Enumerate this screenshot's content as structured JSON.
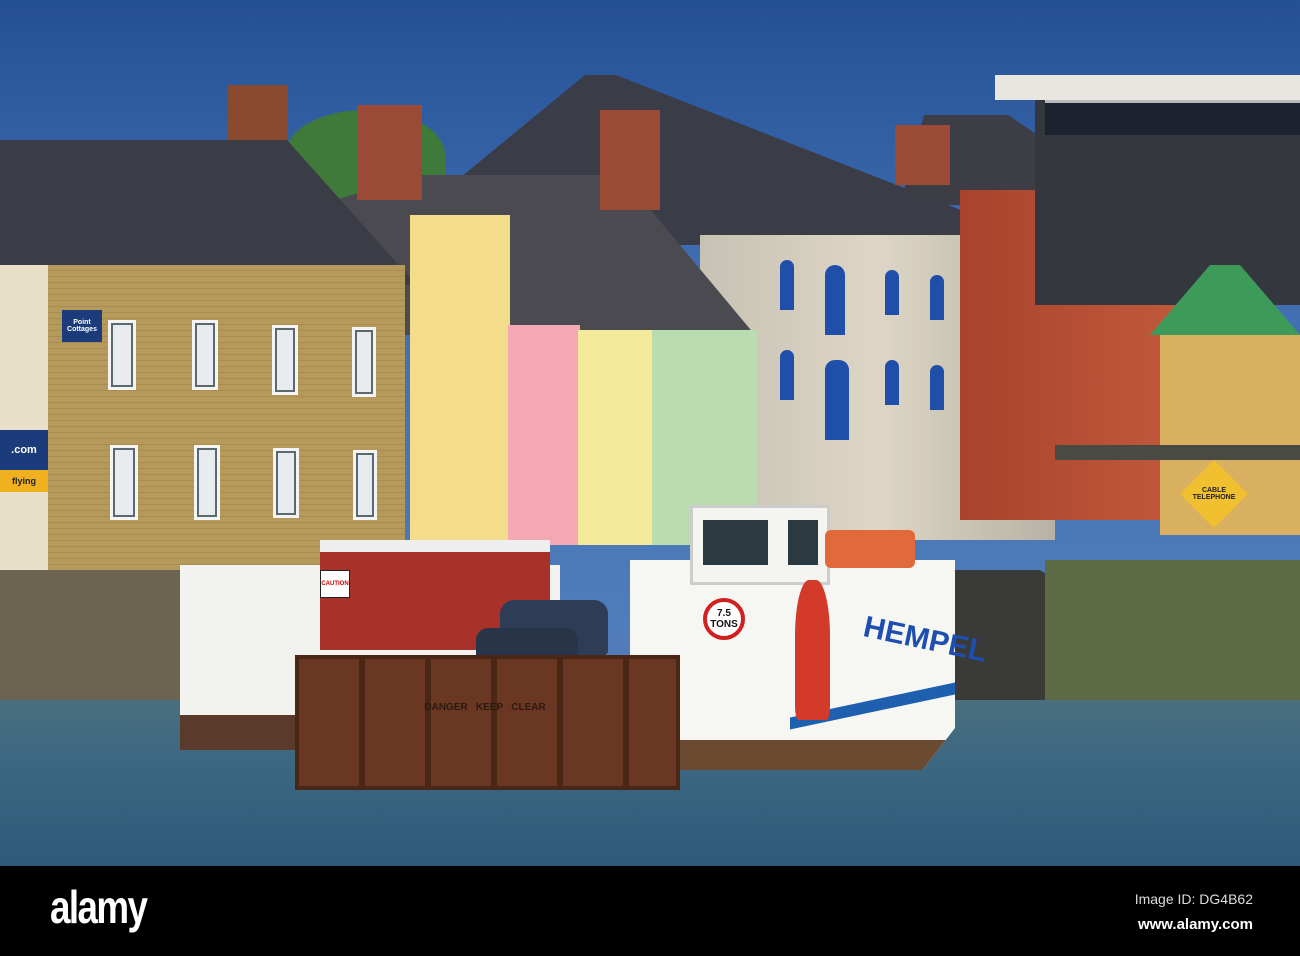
{
  "photo": {
    "signs": {
      "point_cottages": "Point Cottages",
      "flying": "flying",
      "com": ".com",
      "caution": "CAUTION",
      "tons_value": "7.5",
      "tons_unit": "TONS",
      "ramp": "DANGER   KEEP   CLEAR",
      "hull": "HEMPEL",
      "cable_telephone": "CABLE TELEPHONE"
    },
    "colors": {
      "sky": "#2f5ca4",
      "water": "#3b6782",
      "brick": "#b89a5a"
    }
  },
  "watermark": {
    "logo": "alamy",
    "image_id": "Image ID: DG4B62",
    "url": "www.alamy.com"
  }
}
